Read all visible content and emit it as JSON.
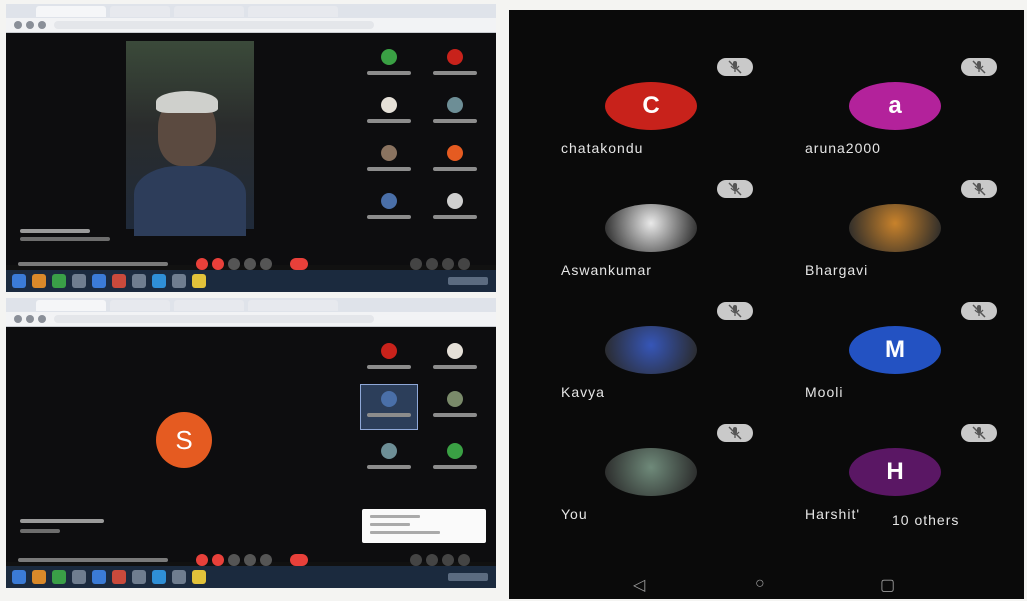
{
  "right_panel": {
    "participants": [
      {
        "name": "chatakondu",
        "avatar_letter": "C",
        "avatar_color": "#c8221b",
        "avatar_type": "letter"
      },
      {
        "name": "aruna2000",
        "avatar_letter": "a",
        "avatar_color": "#b3229b",
        "avatar_type": "letter"
      },
      {
        "name": "Aswankumar",
        "avatar_letter": "",
        "avatar_color": "#e9e9e9",
        "avatar_type": "photo"
      },
      {
        "name": "Bhargavi",
        "avatar_letter": "",
        "avatar_color": "#c8822b",
        "avatar_type": "photo"
      },
      {
        "name": "Kavya",
        "avatar_letter": "",
        "avatar_color": "#3656b8",
        "avatar_type": "photo"
      },
      {
        "name": "Mooli",
        "avatar_letter": "M",
        "avatar_color": "#2352c2",
        "avatar_type": "letter"
      },
      {
        "name": "You",
        "avatar_letter": "",
        "avatar_color": "#6f8a7a",
        "avatar_type": "photo"
      },
      {
        "name": "Harshit'",
        "avatar_letter": "H",
        "avatar_color": "#5a1764",
        "avatar_type": "letter"
      }
    ],
    "others_label": "10 others",
    "nav_icons": [
      "back-icon",
      "home-icon",
      "recents-icon"
    ],
    "mic_muted_icon": "mic-off-icon"
  },
  "left_top": {
    "speaker_avatar": "photo",
    "end_call_color": "#e8403a"
  },
  "left_bottom": {
    "speaker_avatar_letter": "S",
    "speaker_avatar_color": "#e55b21"
  }
}
